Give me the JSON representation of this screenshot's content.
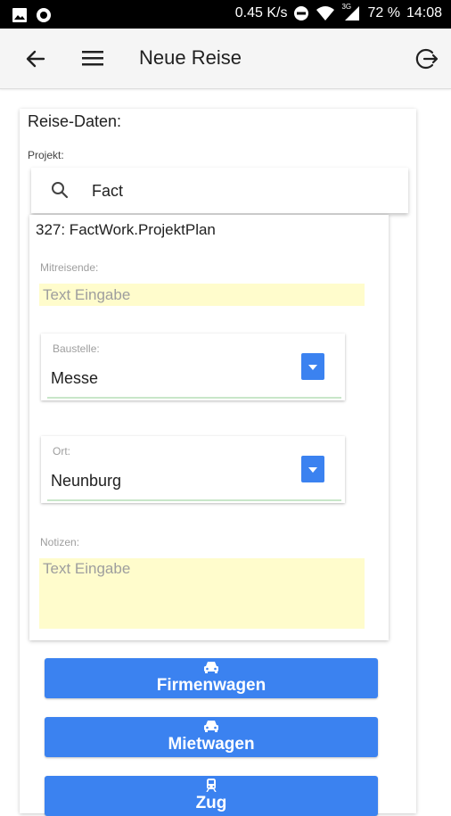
{
  "status_bar": {
    "network_speed": "0.45 K/s",
    "network_type": "3G",
    "battery": "72 %",
    "time": "14:08"
  },
  "app_bar": {
    "title": "Neue Reise"
  },
  "form": {
    "section_title": "Reise-Daten:",
    "projekt_label": "Projekt:",
    "search_value": "Fact",
    "result_title": "327: FactWork.ProjektPlan",
    "mitreisende_label": "Mitreisende:",
    "mitreisende_placeholder": "Text Eingabe",
    "baustelle": {
      "label": "Baustelle:",
      "value": "Messe"
    },
    "ort": {
      "label": "Ort:",
      "value": "Neunburg"
    },
    "notizen_label": "Notizen:",
    "notizen_placeholder": "Text Eingabe"
  },
  "buttons": [
    {
      "label": "Firmenwagen",
      "icon": "car-icon"
    },
    {
      "label": "Mietwagen",
      "icon": "car-icon"
    },
    {
      "label": "Zug",
      "icon": "train-icon"
    }
  ],
  "colors": {
    "accent": "#3b82f0",
    "input_background": "#fffccc",
    "underline": "#c8e6c9",
    "status_bar": "#000000"
  }
}
